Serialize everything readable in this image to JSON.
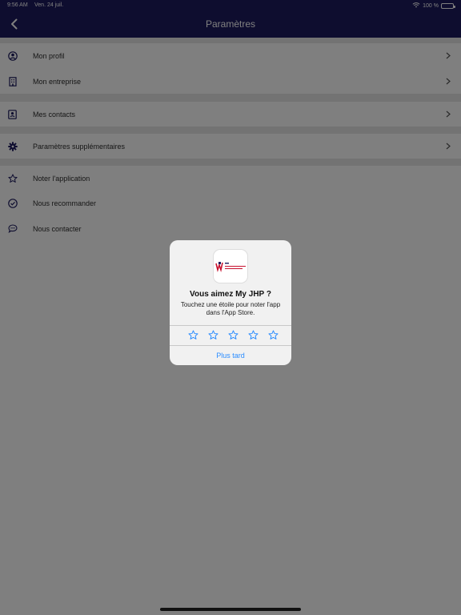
{
  "status_bar": {
    "time": "9:56 AM",
    "date": "Ven. 24 juil.",
    "battery": "100 %"
  },
  "nav": {
    "title": "Paramètres"
  },
  "menu": {
    "group1": [
      {
        "label": "Mon profil",
        "icon": "user-circle-icon"
      },
      {
        "label": "Mon entreprise",
        "icon": "building-icon"
      }
    ],
    "group2": [
      {
        "label": "Mes contacts",
        "icon": "contact-card-icon"
      }
    ],
    "group3": [
      {
        "label": "Paramètres supplémentaires",
        "icon": "gear-icon"
      }
    ],
    "group4": [
      {
        "label": "Noter l'application",
        "icon": "star-icon"
      },
      {
        "label": "Nous recommander",
        "icon": "check-circle-icon"
      },
      {
        "label": "Nous contacter",
        "icon": "chat-bubble-icon"
      }
    ]
  },
  "rating_alert": {
    "title": "Vous aimez My JHP ?",
    "message": "Touchez une étoile pour noter l'app dans l'App Store.",
    "later_label": "Plus tard",
    "stars": 5
  },
  "colors": {
    "nav_bg": "#1d1b5e",
    "accent": "#2a8cff"
  }
}
